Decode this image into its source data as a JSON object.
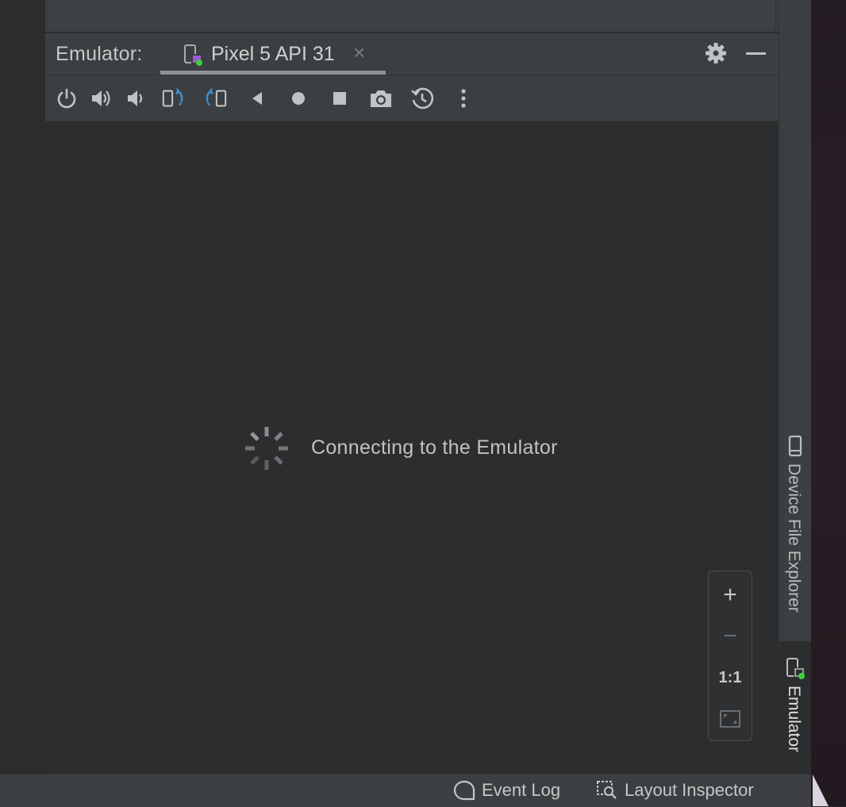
{
  "window": {
    "tool_window_title": "Emulator:",
    "tab": {
      "label": "Pixel 5 API 31",
      "close_glyph": "×",
      "icon": "device-icon"
    },
    "actions": {
      "settings_icon": "gear-icon",
      "minimize_icon": "minimize-icon"
    }
  },
  "toolbar": {
    "buttons": [
      {
        "name": "power-button",
        "icon": "power-icon"
      },
      {
        "name": "volume-up-button",
        "icon": "volume-up-icon"
      },
      {
        "name": "volume-down-button",
        "icon": "volume-down-icon"
      },
      {
        "name": "rotate-left-button",
        "icon": "rotate-left-icon"
      },
      {
        "name": "rotate-right-button",
        "icon": "rotate-right-icon"
      },
      {
        "name": "back-button",
        "icon": "back-triangle-icon"
      },
      {
        "name": "home-button",
        "icon": "home-circle-icon"
      },
      {
        "name": "overview-button",
        "icon": "overview-square-icon"
      },
      {
        "name": "screenshot-button",
        "icon": "camera-icon"
      },
      {
        "name": "snapshot-button",
        "icon": "snapshot-icon"
      },
      {
        "name": "more-button",
        "icon": "more-vertical-icon"
      }
    ]
  },
  "content": {
    "status_text": "Connecting to the Emulator"
  },
  "zoom": {
    "zoom_in": "+",
    "zoom_out": "−",
    "actual_size": "1:1",
    "fit_icon": "fit-screen-icon"
  },
  "side_tabs": {
    "device_file_explorer": "Device File Explorer",
    "emulator": "Emulator"
  },
  "status_bar": {
    "event_log": "Event Log",
    "layout_inspector": "Layout Inspector"
  },
  "colors": {
    "accent_blue": "#3d8fd1",
    "online_green": "#3dd13d",
    "panel": "#3c3f41",
    "background": "#2c2d2f"
  }
}
